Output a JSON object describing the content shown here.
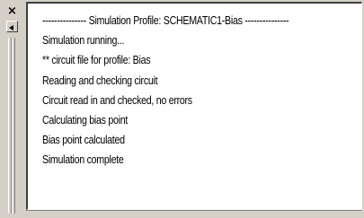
{
  "log": {
    "lines": [
      "--------------- Simulation Profile:  SCHEMATIC1-Bias ---------------",
      "Simulation running...",
      "** circuit file for profile: Bias",
      "Reading and checking circuit",
      "Circuit read in and checked, no errors",
      "Calculating bias point",
      "Bias point calculated",
      "Simulation complete"
    ]
  },
  "icons": {
    "close": "close-icon",
    "pin": "pin-arrow-icon",
    "grip": "dock-grip-icon"
  },
  "colors": {
    "chrome": "#d4d0c8",
    "pane": "#ffffff",
    "text": "#000000"
  }
}
